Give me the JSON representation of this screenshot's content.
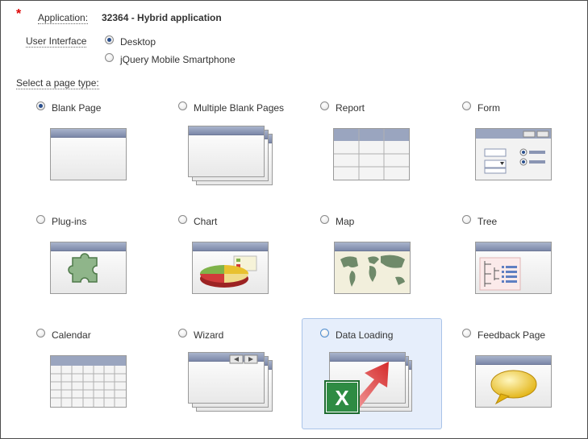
{
  "header": {
    "application_label": "Application:",
    "application_value": "32364 - Hybrid application",
    "ui_label": "User Interface",
    "ui_options": [
      {
        "label": "Desktop",
        "checked": true
      },
      {
        "label": "jQuery Mobile Smartphone",
        "checked": false
      }
    ],
    "page_type_label": "Select a page type:"
  },
  "page_types": [
    {
      "label": "Blank Page",
      "checked": true,
      "icon": "blank-page-icon"
    },
    {
      "label": "Multiple Blank Pages",
      "checked": false,
      "icon": "multiple-blank-pages-icon"
    },
    {
      "label": "Report",
      "checked": false,
      "icon": "report-icon"
    },
    {
      "label": "Form",
      "checked": false,
      "icon": "form-icon"
    },
    {
      "label": "Plug-ins",
      "checked": false,
      "icon": "plugins-icon"
    },
    {
      "label": "Chart",
      "checked": false,
      "icon": "chart-icon"
    },
    {
      "label": "Map",
      "checked": false,
      "icon": "map-icon"
    },
    {
      "label": "Tree",
      "checked": false,
      "icon": "tree-icon"
    },
    {
      "label": "Calendar",
      "checked": false,
      "icon": "calendar-icon"
    },
    {
      "label": "Wizard",
      "checked": false,
      "icon": "wizard-icon"
    },
    {
      "label": "Data Loading",
      "checked": false,
      "icon": "data-loading-icon"
    },
    {
      "label": "Feedback Page",
      "checked": false,
      "icon": "feedback-page-icon"
    }
  ],
  "colors": {
    "required": "#dd0000",
    "selected_tile_bg": "#e6eefb",
    "window_bar": "#8a95b3"
  }
}
